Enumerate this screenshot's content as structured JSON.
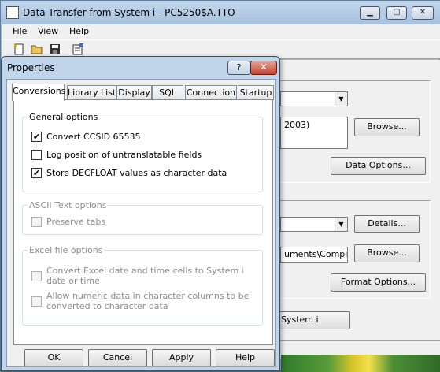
{
  "window": {
    "title": "Data Transfer from System i - PC5250$A.TTO",
    "menu": [
      "File",
      "View",
      "Help"
    ],
    "toolbar_icons": [
      "new-file-icon",
      "open-folder-icon",
      "save-icon",
      "properties-icon"
    ],
    "fields": {
      "from_combo_value": "",
      "file_list_value": "2003)",
      "output_path_value": "uments\\Compile"
    },
    "buttons": {
      "browse_top": "Browse...",
      "data_options": "Data Options...",
      "details": "Details...",
      "browse_bottom": "Browse...",
      "format_options": "Format Options...",
      "transfer": "System i"
    }
  },
  "dialog": {
    "title": "Properties",
    "title_help_glyph": "?",
    "title_close_glyph": "✕",
    "tabs": [
      {
        "label": "Conversions",
        "active": true
      },
      {
        "label": "Library List",
        "active": false
      },
      {
        "label": "Display",
        "active": false
      },
      {
        "label": "SQL",
        "active": false
      },
      {
        "label": "Connection",
        "active": false
      },
      {
        "label": "Startup",
        "active": false
      }
    ],
    "general": {
      "legend": "General options",
      "options": [
        {
          "label": "Convert CCSID 65535",
          "checked": true
        },
        {
          "label": "Log position of untranslatable fields",
          "checked": false
        },
        {
          "label": "Store DECFLOAT values as character data",
          "checked": true
        }
      ]
    },
    "ascii": {
      "legend": "ASCII Text options",
      "options": [
        {
          "label": "Preserve tabs",
          "checked": false
        }
      ]
    },
    "excel": {
      "legend": "Excel file options",
      "options": [
        {
          "label": "Convert Excel date and time cells to System i date or time",
          "checked": false
        },
        {
          "label": "Allow numeric data in character columns to be converted to character data",
          "checked": false
        }
      ]
    },
    "buttons": {
      "ok": "OK",
      "cancel": "Cancel",
      "apply": "Apply",
      "help": "Help"
    }
  }
}
